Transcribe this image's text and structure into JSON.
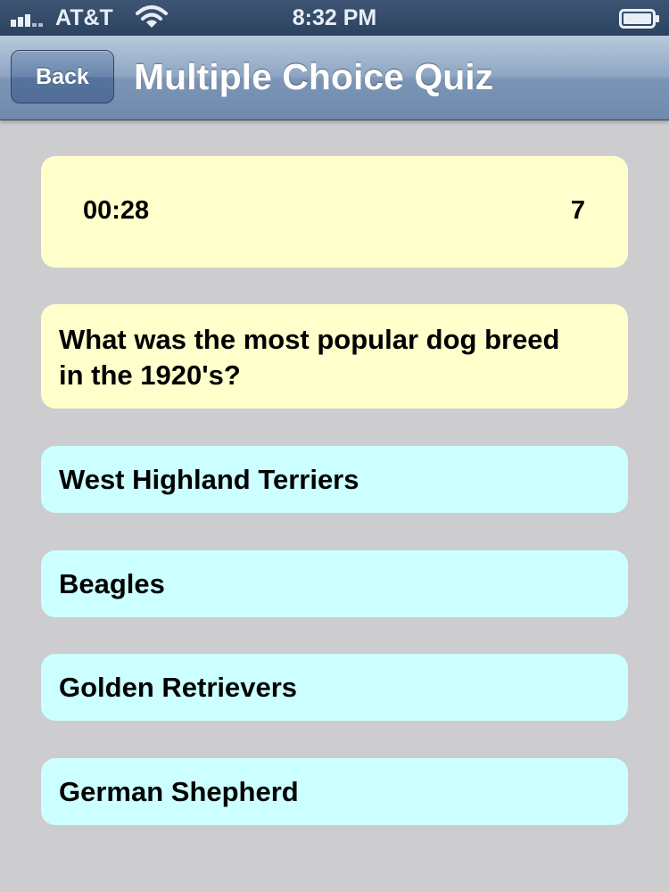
{
  "status_bar": {
    "carrier": "AT&T",
    "time": "8:32 PM",
    "signal_icon": "signal-bars-icon",
    "wifi_icon": "wifi-icon",
    "battery_icon": "battery-icon"
  },
  "nav": {
    "back_label": "Back",
    "title": "Multiple Choice Quiz"
  },
  "quiz": {
    "timer": "00:28",
    "score": "7",
    "question": "What was the most popular dog breed in the 1920's?",
    "answers": [
      "West Highland Terriers",
      "Beagles",
      "Golden Retrievers",
      "German Shepherd"
    ]
  },
  "colors": {
    "background": "#cdcdd0",
    "info_card": "#ffffcc",
    "answer_card": "#ccffff",
    "nav_bar": "#7b95b6"
  }
}
